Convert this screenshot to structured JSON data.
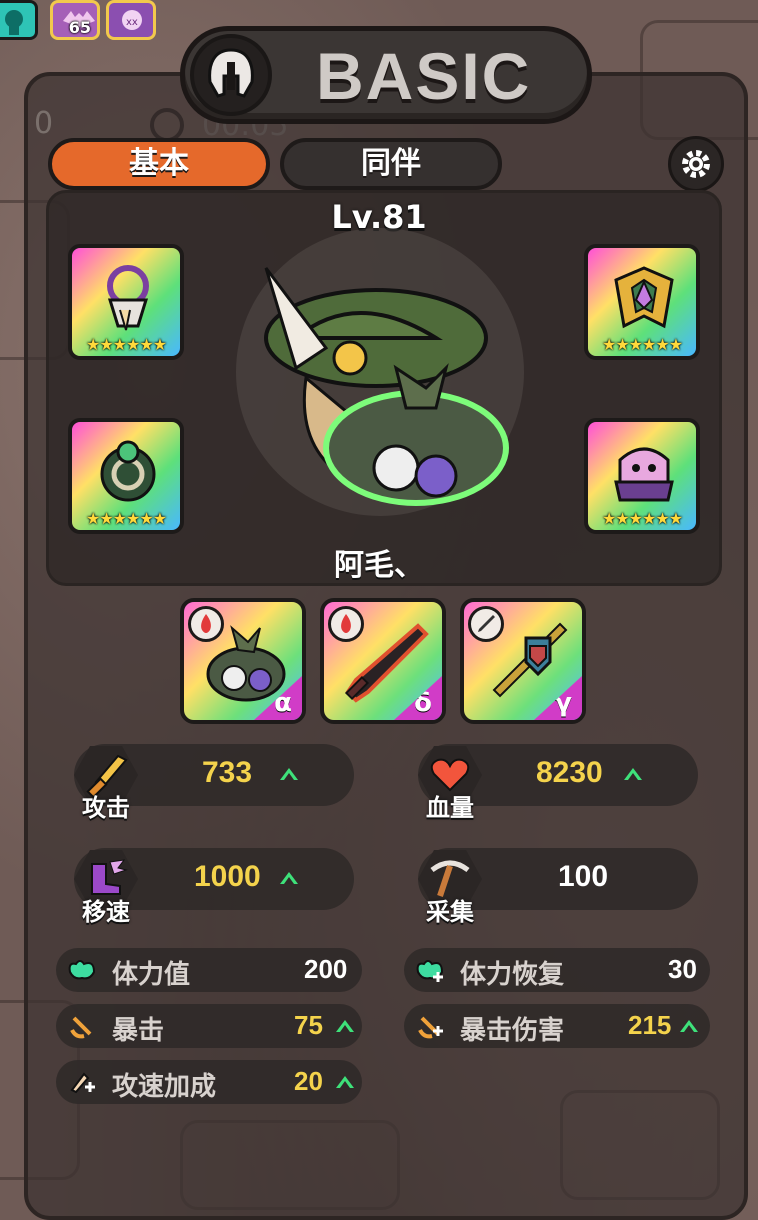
{
  "top_icons": [
    {
      "name": "reaper-icon",
      "count": ""
    },
    {
      "name": "bat-icon",
      "count": "65"
    },
    {
      "name": "skull-icon",
      "count": ""
    }
  ],
  "header": {
    "title": "BASIC",
    "ghost_counter": "0",
    "ghost_timer": "00:05"
  },
  "tabs": [
    {
      "label": "基本",
      "active": true
    },
    {
      "label": "同伴",
      "active": false
    }
  ],
  "hero": {
    "level": "Lv.81",
    "name": "阿毛、"
  },
  "equipment": [
    {
      "slot": "top-left",
      "icon": "skull-necklace-icon",
      "stars": "★★★★★★"
    },
    {
      "slot": "top-right",
      "icon": "golden-armor-icon",
      "stars": "★★★★★★"
    },
    {
      "slot": "bottom-left",
      "icon": "jade-ring-icon",
      "stars": "★★★★★★"
    },
    {
      "slot": "bottom-right",
      "icon": "pink-beast-boots-icon",
      "stars": "★★★★★★"
    }
  ],
  "skills": [
    {
      "icon": "fish-head-icon",
      "element": "fire-icon",
      "greek": "α"
    },
    {
      "icon": "dark-sword-icon",
      "element": "fire-icon",
      "greek": "δ"
    },
    {
      "icon": "halberd-icon",
      "element": "blade-icon",
      "greek": "γ"
    }
  ],
  "main_stats": [
    {
      "label": "攻击",
      "value": "733",
      "icon": "sword-icon",
      "upgrade": true
    },
    {
      "label": "血量",
      "value": "8230",
      "icon": "heart-icon",
      "upgrade": true
    },
    {
      "label": "移速",
      "value": "1000",
      "icon": "boot-icon",
      "upgrade": true
    },
    {
      "label": "采集",
      "value": "100",
      "icon": "pickaxe-icon",
      "upgrade": false
    }
  ],
  "sub_stats": [
    {
      "label": "体力值",
      "value": "200",
      "icon": "stamina-icon",
      "upgrade": false
    },
    {
      "label": "体力恢复",
      "value": "30",
      "icon": "stamina-regen-icon",
      "upgrade": false
    },
    {
      "label": "暴击",
      "value": "75",
      "icon": "crit-icon",
      "upgrade": true
    },
    {
      "label": "暴击伤害",
      "value": "215",
      "icon": "crit-damage-icon",
      "upgrade": true
    },
    {
      "label": "攻速加成",
      "value": "20",
      "icon": "attack-speed-icon",
      "upgrade": true
    }
  ],
  "colors": {
    "accent_orange": "#e5692b",
    "stat_yellow": "#f4d34c",
    "upgrade_green": "#3ee17a"
  }
}
